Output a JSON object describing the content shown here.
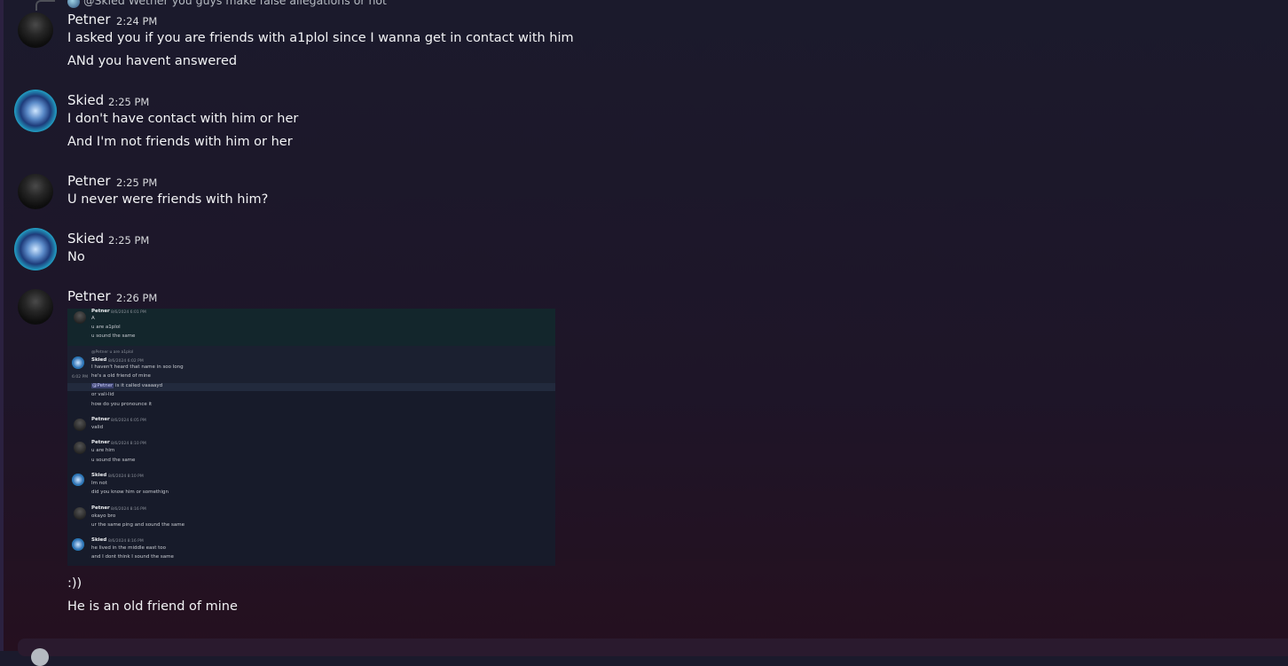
{
  "reply_ref": "@Skied  Wether you guys make false allegations or not",
  "messages": [
    {
      "author": "Petner",
      "time": "2:24 PM",
      "lines": [
        "I asked you if you are friends with a1plol since I wanna get in contact with him",
        "ANd you havent answered"
      ]
    },
    {
      "author": "Skied",
      "time": "2:25 PM",
      "lines": [
        "I don't have contact with him or her",
        "And I'm not friends with him or her"
      ]
    },
    {
      "author": "Petner",
      "time": "2:25 PM",
      "lines": [
        "U never were friends with him?"
      ]
    },
    {
      "author": "Skied",
      "time": "2:25 PM",
      "lines": [
        "No"
      ]
    },
    {
      "author": "Petner",
      "time": "2:26 PM",
      "lines": [
        ":))",
        "He is an old friend of mine"
      ]
    }
  ],
  "embed": {
    "b1_name": "Petner",
    "b1_date": "8/6/2024 6:01 PM",
    "b1_l1": "A",
    "b1_l2": "u are a1plol",
    "b1_l3": "u sound the same",
    "b2_reply": "@Petner u are a1plol",
    "b2_name": "Skied",
    "b2_date": "8/6/2024 6:02 PM",
    "b2_l1": "I haven't heard that name in soo long",
    "b2_side": "6:02 PM",
    "b2_l2": "he's a old friend of mine",
    "b2_mention": "@Petner",
    "b2_l3": "is it called vaaaayd",
    "b2_l4": "or vali-lid",
    "b2_l5": "how do you pronounce it",
    "b3_name": "Petner",
    "b3_date": "8/6/2024 6:05 PM",
    "b3_l1": "valid",
    "b4_name": "Petner",
    "b4_date": "8/6/2024 8:10 PM",
    "b4_l1": "u are him",
    "b4_l2": "u sound the same",
    "b5_name": "Skied",
    "b5_date": "8/6/2024 8:10 PM",
    "b5_l1": "Im not",
    "b5_l2": "did you know him or somethign",
    "b6_name": "Petner",
    "b6_date": "8/6/2024 8:16 PM",
    "b6_l1": "okayo bro",
    "b6_l2": "ur the same ping and sound the same",
    "b7_name": "Skied",
    "b7_date": "8/6/2024 8:16 PM",
    "b7_l1": "he lived in the middle east too",
    "b7_l2": "and I dont think I sound the same"
  }
}
